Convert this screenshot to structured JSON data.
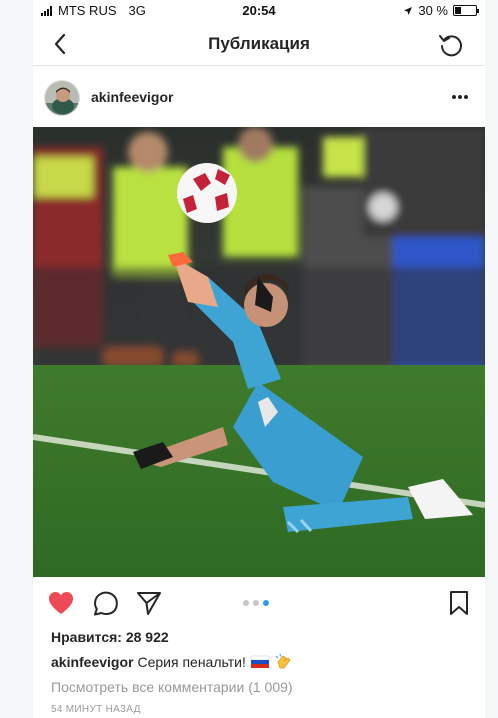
{
  "status_bar": {
    "carrier": "MTS RUS",
    "network": "3G",
    "time": "20:54",
    "battery": "30 %",
    "battery_level": 0.3
  },
  "nav": {
    "title": "Публикация",
    "back_icon": "chevron-left-icon",
    "refresh_icon": "refresh-icon"
  },
  "post": {
    "username": "akinfeevigor",
    "more_icon": "more-horizontal-icon",
    "photo_description": "goalkeeper-kick-save-photo",
    "carousel_total": 3,
    "carousel_active": 3,
    "likes": "Нравится: 28 922",
    "caption": {
      "username": "akinfeevigor",
      "text": "Серия пенальти!",
      "emojis": [
        "russia-flag-icon",
        "clapping-hands-icon"
      ]
    },
    "view_comments": "Посмотреть все комментарии (1 009)",
    "time_ago": "54 МИНУТ НАЗАД"
  },
  "colors": {
    "like_red": "#ed4956",
    "accent_blue": "#3897f0",
    "muted": "#999999",
    "text": "#262626"
  }
}
